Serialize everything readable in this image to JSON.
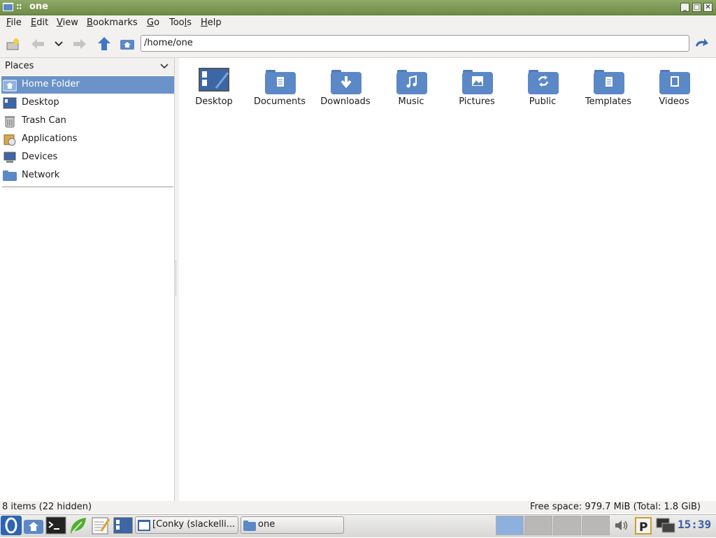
{
  "window": {
    "title": "one",
    "dots": "::"
  },
  "menu": [
    {
      "label": "File",
      "u": "F",
      "rest": "ile"
    },
    {
      "label": "Edit",
      "u": "E",
      "rest": "dit"
    },
    {
      "label": "View",
      "u": "V",
      "rest": "iew"
    },
    {
      "label": "Bookmarks",
      "u": "B",
      "rest": "ookmarks"
    },
    {
      "label": "Go",
      "u": "G",
      "rest": "o"
    },
    {
      "label": "Tools",
      "pre": "Too",
      "u": "l",
      "rest": "s"
    },
    {
      "label": "Help",
      "u": "H",
      "rest": "elp"
    }
  ],
  "location": {
    "path": "/home/one"
  },
  "sidebar": {
    "header": "Places",
    "items": [
      {
        "label": "Home Folder",
        "icon": "home-folder-icon",
        "selected": true
      },
      {
        "label": "Desktop",
        "icon": "desktop-icon"
      },
      {
        "label": "Trash Can",
        "icon": "trash-icon"
      },
      {
        "label": "Applications",
        "icon": "applications-icon"
      },
      {
        "label": "Devices",
        "icon": "computer-icon"
      },
      {
        "label": "Network",
        "icon": "network-folder-icon"
      }
    ]
  },
  "files": [
    {
      "label": "Desktop",
      "icon": "desktop-icon"
    },
    {
      "label": "Documents",
      "icon": "documents-folder-icon"
    },
    {
      "label": "Downloads",
      "icon": "downloads-folder-icon"
    },
    {
      "label": "Music",
      "icon": "music-folder-icon"
    },
    {
      "label": "Pictures",
      "icon": "pictures-folder-icon"
    },
    {
      "label": "Public",
      "icon": "public-folder-icon"
    },
    {
      "label": "Templates",
      "icon": "templates-folder-icon"
    },
    {
      "label": "Videos",
      "icon": "videos-folder-icon"
    }
  ],
  "status": {
    "left": "8 items (22 hidden)",
    "right": "Free space: 979.7 MiB (Total: 1.8 GiB)"
  },
  "taskbar": {
    "tasks": [
      {
        "label": "[Conky (slackelli...",
        "icon": "window-icon"
      },
      {
        "label": "one",
        "icon": "folder-icon"
      }
    ],
    "clock": "15:39"
  },
  "colors": {
    "accent": "#6b93c9",
    "titlebar": "#7a9652",
    "folder": "#5b88c6"
  }
}
